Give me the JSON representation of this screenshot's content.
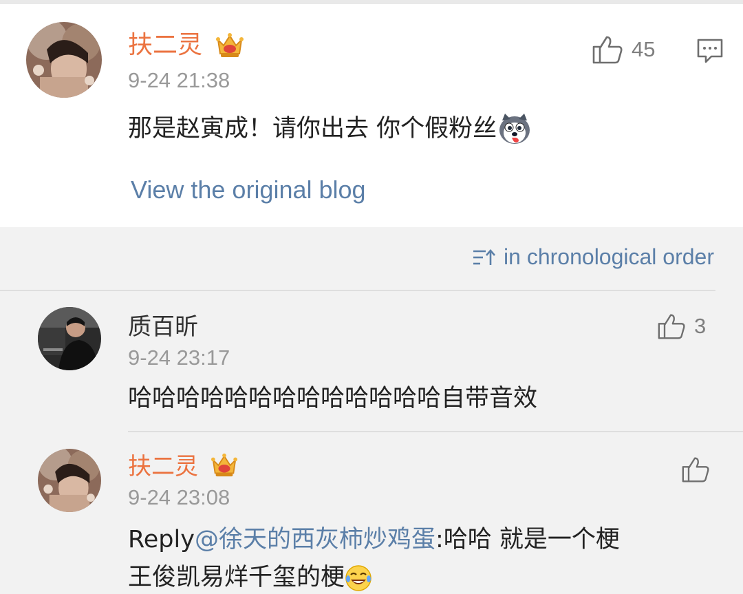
{
  "main_post": {
    "username": "扶二灵",
    "timestamp": "9-24 21:38",
    "like_count": "45",
    "content": "那是赵寅成！请你出去 你个假粉丝",
    "view_original": "View the original blog"
  },
  "sort": {
    "label": "in chronological order"
  },
  "comments": [
    {
      "username": "质百昕",
      "timestamp": "9-24 23:17",
      "like_count": "3",
      "content": "哈哈哈哈哈哈哈哈哈哈哈哈哈自带音效"
    },
    {
      "username": "扶二灵",
      "timestamp": "9-24 23:08",
      "reply_prefix": "Reply",
      "reply_mention": "@徐天的西灰柿炒鸡蛋",
      "reply_text": ":哈哈 就是一个梗",
      "content_line2": "王俊凯易烊千玺的梗"
    }
  ],
  "colors": {
    "username": "#eb7340",
    "link": "#5b7fa8",
    "timestamp": "#999999",
    "background": "#f2f2f2"
  }
}
